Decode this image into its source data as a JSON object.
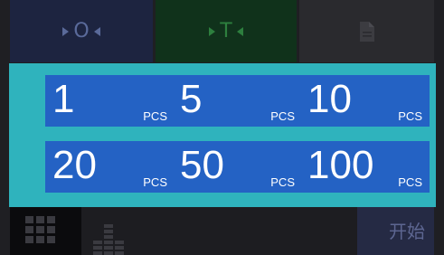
{
  "top_bar": {
    "zero_label": "O",
    "tare_label": "T"
  },
  "presets": [
    {
      "value": "1",
      "unit": "PCS"
    },
    {
      "value": "5",
      "unit": "PCS"
    },
    {
      "value": "10",
      "unit": "PCS"
    },
    {
      "value": "20",
      "unit": "PCS"
    },
    {
      "value": "50",
      "unit": "PCS"
    },
    {
      "value": "100",
      "unit": "PCS"
    }
  ],
  "bottom_bar": {
    "start_label": "开始"
  },
  "icons": {
    "grid": "grid-icon",
    "equalizer": "bar-chart-icon",
    "document": "document-icon"
  },
  "colors": {
    "panel": "#2fb3bd",
    "preset_button": "#2462c4"
  }
}
